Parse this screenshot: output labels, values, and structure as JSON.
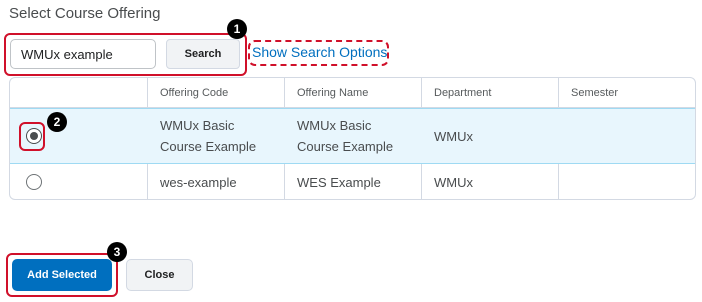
{
  "dialog": {
    "title": "Select Course Offering"
  },
  "search": {
    "value": "WMUx example",
    "button_label": "Search",
    "options_link": "Show Search Options"
  },
  "table": {
    "columns": [
      "Offering Code",
      "Offering Name",
      "Department",
      "Semester"
    ],
    "rows": [
      {
        "selected": true,
        "code": "WMUx Basic\nCourse Example",
        "name": "WMUx Basic\nCourse Example",
        "department": "WMUx",
        "semester": ""
      },
      {
        "selected": false,
        "code": "wes-example",
        "name": "WES Example",
        "department": "WMUx",
        "semester": ""
      }
    ]
  },
  "footer": {
    "add_label": "Add Selected",
    "close_label": "Close"
  },
  "callouts": [
    "1",
    "2",
    "3"
  ],
  "colors": {
    "accent": "#006fbf",
    "callout_red": "#d0102a",
    "selected_row": "#e8f6fd"
  }
}
